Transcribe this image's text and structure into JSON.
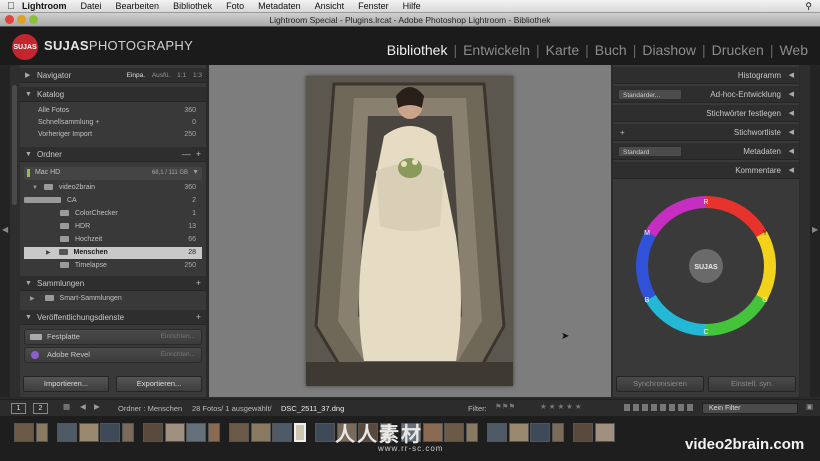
{
  "menubar": {
    "items": [
      "Lightroom",
      "Datei",
      "Bearbeiten",
      "Bibliothek",
      "Foto",
      "Metadaten",
      "Ansicht",
      "Fenster",
      "Hilfe"
    ],
    "search_icon": "magnifier-icon"
  },
  "window": {
    "title": "Lightroom Special - Plugins.lrcat - Adobe Photoshop Lightroom - Bibliothek"
  },
  "identity": {
    "logo_badge": "SUJAS",
    "logo_bold": "SUJAS",
    "logo_rest": "PHOTOGRAPHY"
  },
  "modules": [
    "Bibliothek",
    "Entwickeln",
    "Karte",
    "Buch",
    "Diashow",
    "Drucken",
    "Web"
  ],
  "left": {
    "navigator": {
      "title": "Navigator",
      "options": [
        "Einpa.",
        "Ausfü.",
        "1:1",
        "1:3"
      ]
    },
    "katalog": {
      "title": "Katalog",
      "rows": [
        {
          "label": "Alle Fotos",
          "value": "360"
        },
        {
          "label": "Schnellsammlung  +",
          "value": "0"
        },
        {
          "label": "Vorheriger Import",
          "value": "250"
        }
      ]
    },
    "ordner": {
      "title": "Ordner",
      "volume": {
        "label": "Mac HD",
        "value": "68,1 / 111 GB"
      },
      "root": {
        "label": "video2brain",
        "value": "360"
      },
      "folders": [
        {
          "label": "CA",
          "value": "2"
        },
        {
          "label": "ColorChecker",
          "value": "1"
        },
        {
          "label": "HDR",
          "value": "13"
        },
        {
          "label": "Hochzeit",
          "value": "66"
        },
        {
          "label": "Menschen",
          "value": "28"
        },
        {
          "label": "Timelapse",
          "value": "250"
        }
      ]
    },
    "sammlungen": {
      "title": "Sammlungen",
      "item": "Smart-Sammlungen"
    },
    "services": {
      "title": "Veröffentlichungsdienste",
      "items": [
        {
          "label": "Festplatte",
          "action": "Einrichten..."
        },
        {
          "label": "Adobe Revel",
          "action": "Einrichten..."
        }
      ]
    },
    "import_label": "Importieren...",
    "export_label": "Exportieren..."
  },
  "right": {
    "histogram": "Histogramm",
    "adhoc": {
      "title": "Ad-hoc-Entwicklung",
      "preset": "Standarder..."
    },
    "keywords_set": "Stichwörter festlegen",
    "keyword_list": "Stichwortliste",
    "metadata": {
      "title": "Metadaten",
      "preset": "Standard"
    },
    "comments": "Kommentare",
    "wheel_letters": [
      "R",
      "Y",
      "G",
      "C",
      "B",
      "M"
    ],
    "wheel_center": "SUJAS",
    "sync_label": "Synchronisieren",
    "sync_settings_label": "Einstell. syn."
  },
  "toolbar": {
    "page1": "1",
    "page2": "2",
    "source": "Ordner : Menschen",
    "count": "28 Fotos/ 1 ausgewählt/",
    "filename": "DSC_2511_37.dng",
    "filter_label": "Filter:",
    "filter_value": "Kein Filter"
  },
  "filmstrip": {
    "thumb_count": 28,
    "selected_index": 13
  },
  "watermark": {
    "main": "人人素材",
    "url": "www.rr-sc.com"
  },
  "brand": "video2brain.com",
  "colors": {
    "accent_red": "#c4262e",
    "panel_bg": "#393939",
    "center_bg": "#7d7d7d"
  }
}
